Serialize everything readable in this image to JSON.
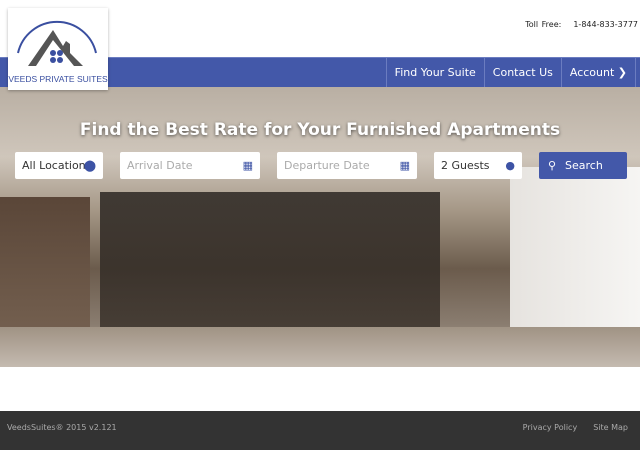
{
  "header": {
    "logo_text": "VEEDS PRIVATE SUITES",
    "toll_free_label": "Toll Free:",
    "phone": "1-844-833-3777"
  },
  "nav": {
    "items": [
      {
        "label": "Find Your Suite"
      },
      {
        "label": "Contact Us"
      },
      {
        "label": "Account ❯"
      }
    ]
  },
  "hero": {
    "headline": "Find the Best Rate for Your Furnished Apartments"
  },
  "search": {
    "location": "All Locations",
    "arrival_placeholder": "Arrival Date",
    "departure_placeholder": "Departure Date",
    "guests": "2 Guests",
    "button": "Search"
  },
  "footer": {
    "copyright": "VeedsSuites® 2015 v2.121",
    "links": [
      "Privacy Policy",
      "Site Map"
    ]
  },
  "colors": {
    "brand": "#4358a9",
    "footer": "#333333"
  }
}
